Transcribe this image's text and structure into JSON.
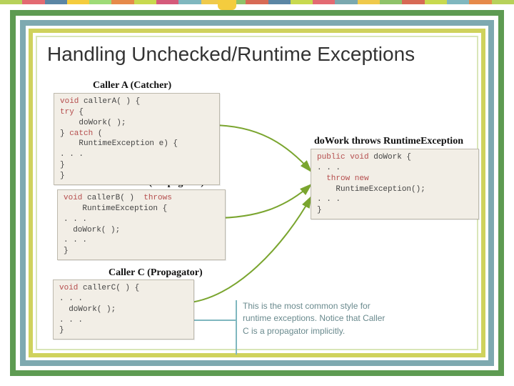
{
  "topbar_colors": [
    "#b7d15a",
    "#e36a72",
    "#5b86a5",
    "#f4cc3e",
    "#9edb78",
    "#e68a4a",
    "#c8d94f",
    "#d55a7b",
    "#7fb7bf",
    "#efc94c",
    "#8fc26a",
    "#d76a55",
    "#5b86a5",
    "#c8d94f",
    "#e36a72",
    "#7aa8af",
    "#efc94c",
    "#8fc26a",
    "#d76a55",
    "#c8d94f",
    "#7fb7bf",
    "#e68a4a",
    "#b7d15a"
  ],
  "title": "Handling Unchecked/Runtime Exceptions",
  "headers": {
    "a": "Caller A (Catcher)",
    "b": "Caller B (Propagator)",
    "c": "Caller C (Propagator)",
    "d": "doWork throws RuntimeException"
  },
  "code": {
    "a": {
      "l1a": "void",
      "l1b": " callerA( ) {",
      "l2": "try",
      "l2b": " {",
      "l3": "    doWork( );",
      "l4": "} ",
      "l4b": "catch",
      "l4c": " (",
      "l5": "    RuntimeException e) {",
      "l6": ". . .",
      "l7": "}",
      "l8": "}"
    },
    "b": {
      "l1a": "void",
      "l1b": " callerB( )  ",
      "l1c": "throws",
      "l2": "    RuntimeException {",
      "l3": ". . .",
      "l4": "  doWork( );",
      "l5": ". . .",
      "l6": "}"
    },
    "c": {
      "l1a": "void",
      "l1b": " callerC( ) {",
      "l2": ". . .",
      "l3": "  doWork( );",
      "l4": ". . .",
      "l5": "}"
    },
    "d": {
      "l1a": "public void",
      "l1b": " doWork {",
      "l2": ". . .",
      "l3a": "  throw new",
      "l4": "    RuntimeException();",
      "l5": ". . .",
      "l6": "}"
    }
  },
  "note": "This is the most common style for runtime exceptions. Notice that Caller C is a propagator implicitly."
}
